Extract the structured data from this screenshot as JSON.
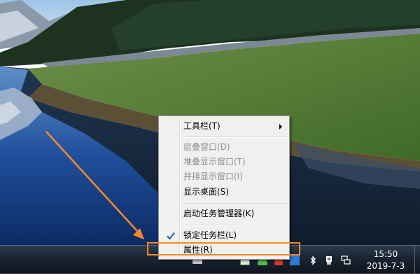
{
  "context_menu": {
    "toolbar_label": "工具栏(T)",
    "cascade_label": "层叠窗口(D)",
    "stacked_label": "堆叠显示窗口(T)",
    "side_by_side_label": "并排显示窗口(I)",
    "show_desktop_label": "显示桌面(S)",
    "task_manager_label": "启动任务管理器(K)",
    "lock_taskbar_label": "锁定任务栏(L)",
    "properties_label": "属性(R)"
  },
  "clock": {
    "time": "15:50",
    "date": "2019-7-3"
  },
  "colors": {
    "annotation": "#f58a2a",
    "menu_background": "#f0f0f0",
    "taskbar": "#1a2431"
  },
  "icons": [
    "bluetooth-icon",
    "usb-device-icon",
    "network-icon",
    "checkmark-icon",
    "submenu-arrow-icon"
  ]
}
